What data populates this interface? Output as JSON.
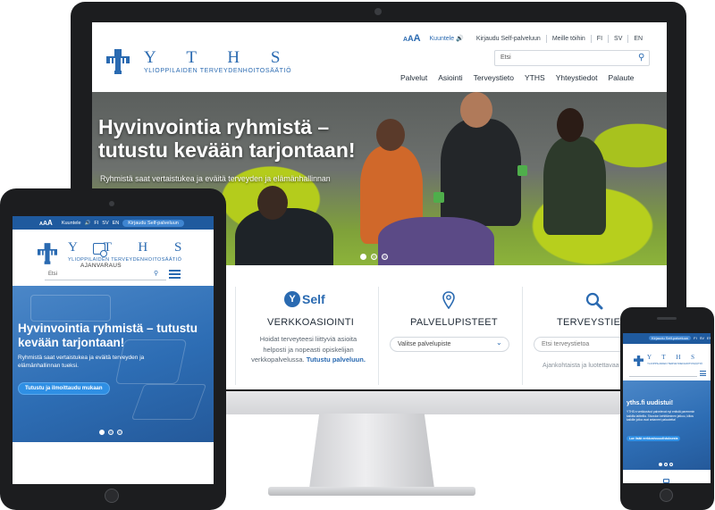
{
  "colors": {
    "brand_blue": "#2a6ab1",
    "dark_bar": "#1f5a9e",
    "button_blue": "#2f8fe4",
    "device_black": "#1c1d1f"
  },
  "desktop": {
    "brand": "Y T H S",
    "brand_sub": "YLIOPPILAIDEN TERVEYDENHOITOSÄÄTIÖ",
    "util": {
      "aaa": [
        "A",
        "A",
        "A"
      ],
      "listen": "Kuuntele",
      "links": [
        "Kirjaudu Self-palveluun",
        "Meille töihin",
        "FI",
        "SV",
        "EN"
      ]
    },
    "search_placeholder": "Etsi",
    "nav": [
      "Palvelut",
      "Asiointi",
      "Terveystieto",
      "YTHS",
      "Yhteystiedot",
      "Palaute"
    ],
    "hero": {
      "title": "Hyvinvointia ryhmistä – tutustu kevään tarjontaan!",
      "subtitle": "Ryhmistä saat vertaistukea ja eväitä terveyden ja elämänhallinnan"
    },
    "cards": [
      {
        "logo_letter": "Y",
        "logo_text": "Self",
        "title": "VERKKOASIOINTI",
        "text": "Hoidat terveyteesi liittyviä asioita helposti ja nopeasti opiskelijan verkkopalvelussa.",
        "link": "Tutustu palveluun."
      },
      {
        "title": "PALVELUPISTEET",
        "select": "Valitse palvelupiste"
      },
      {
        "title": "TERVEYSTIETO",
        "search": "Etsi terveystietoa",
        "text": "Ajankohtaista ja luotettavaa"
      }
    ]
  },
  "tablet": {
    "util": {
      "aaa": [
        "A",
        "A",
        "A"
      ],
      "listen": "Kuuntele",
      "langs": [
        "FI",
        "SV",
        "EN"
      ],
      "login": "Kirjaudu Self-palveluun"
    },
    "brand": "Y T H S",
    "brand_sub": "YLIOPPILAIDEN TERVEYDENHOITOSÄÄTIÖ",
    "search_placeholder": "Etsi",
    "hero": {
      "title": "Hyvinvointia ryhmistä – tutustu kevään tarjontaan!",
      "subtitle": "Ryhmistä saat vertaistukea ja eväitä terveyden ja elämänhallinnan tueksi.",
      "button": "Tutustu ja ilmoittaudu mukaan"
    },
    "section_label": "AJANVARAUS"
  },
  "phone": {
    "util": {
      "login": "Kirjaudu Self-palveluun",
      "langs": [
        "FI",
        "SV",
        "EN"
      ]
    },
    "brand": "Y T H S",
    "brand_sub": "YLIOPPILAIDEN TERVEYDENHOITOSÄÄTIÖ",
    "hero": {
      "title": "yths.fi uudistui!",
      "subtitle": "YTHS:n verkkosivut palvelevat nyt entistä paremmin kaikilla laitteilla. Sivuston kehittäminen jatkuu, kiitos kaikille jotka ovat antaneet palautetta!",
      "button": "Lue lisää verkkosivuuudistuksesta"
    }
  }
}
